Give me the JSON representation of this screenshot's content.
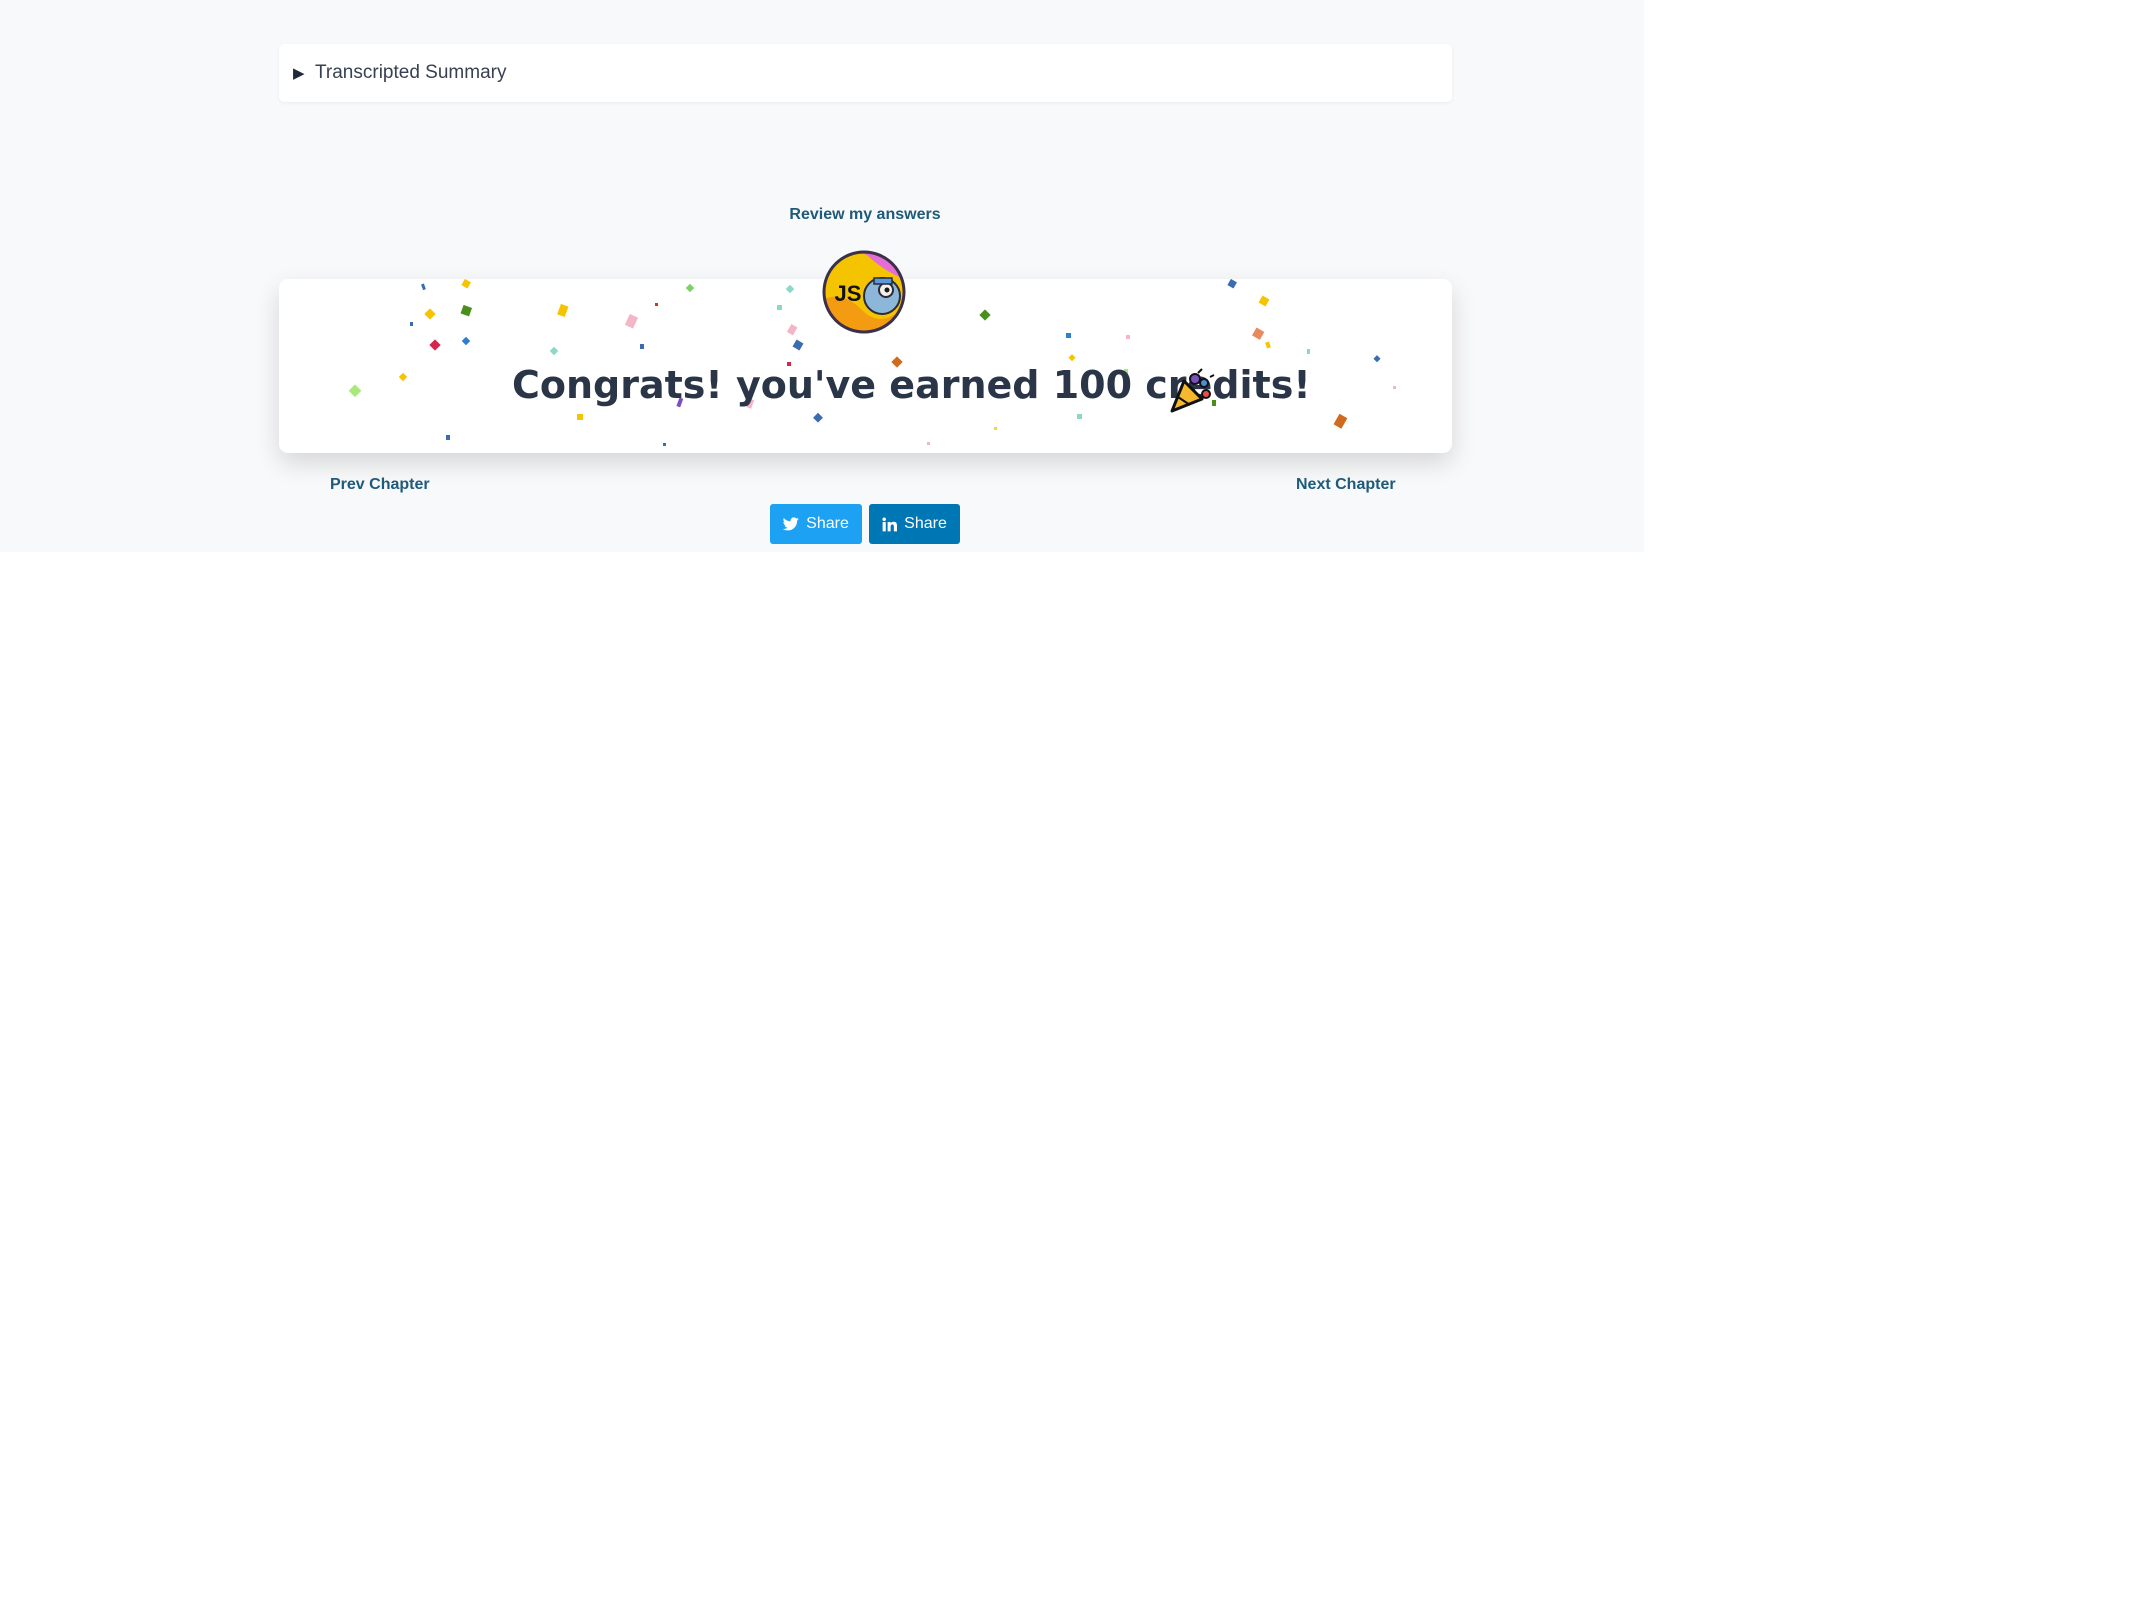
{
  "summary": {
    "toggle_icon": "triangle-right-icon",
    "label": "Transcripted Summary"
  },
  "review": {
    "label": "Review my answers"
  },
  "badge": {
    "text": "JS",
    "icon": "js-mascot-badge"
  },
  "congrats": {
    "message": "Congrats! you've earned 100 credits!",
    "icon": "party-popper-icon"
  },
  "nav": {
    "prev_label": "Prev Chapter",
    "next_label": "Next Chapter"
  },
  "share": {
    "twitter_label": "Share",
    "twitter_icon": "twitter-icon",
    "linkedin_label": "Share",
    "linkedin_icon": "linkedin-icon"
  },
  "colors": {
    "background": "#f8f9fa",
    "link": "#1e5a7a",
    "text": "#2a3547",
    "twitter": "#1da1f2",
    "linkedin": "#0077b5"
  }
}
